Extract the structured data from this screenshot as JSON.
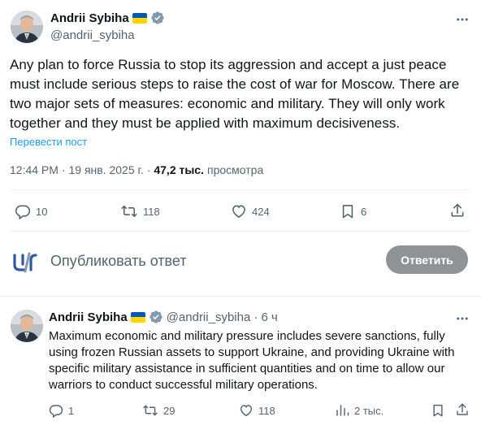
{
  "main_post": {
    "author_name": "Andrii Sybiha",
    "author_handle": "@andrii_sybiha",
    "text": "Any plan to force Russia to stop its aggression and accept a just peace must include serious steps to raise the cost of war for Moscow. There are two major sets of measures: economic and military. They will only work together and they must be applied with maximum decisiveness.",
    "translate_label": "Перевести пост",
    "time": "12:44 PM",
    "date": "· 19 янв. 2025 г. ·",
    "views_count": "47,2 тыс.",
    "views_label": "просмотра",
    "actions": {
      "replies": "10",
      "reposts": "118",
      "likes": "424",
      "bookmarks": "6"
    }
  },
  "reply_composer": {
    "placeholder": "Опубликовать ответ",
    "button_label": "Ответить"
  },
  "reply_post": {
    "author_name": "Andrii Sybiha",
    "author_handle": "@andrii_sybiha",
    "time_ago": "· 6 ч",
    "text": "Maximum economic and military pressure includes severe sanctions, fully using frozen Russian assets to support Ukraine, and providing Ukraine with specific military assistance in sufficient quantities and on time to allow our warriors to conduct successful military operations.",
    "actions": {
      "replies": "1",
      "reposts": "29",
      "likes": "118",
      "views": "2 тыс."
    }
  },
  "colors": {
    "accent": "#1d9bf0",
    "muted_text": "#536471",
    "button_disabled": "#8e9396",
    "flag_blue": "#0057b7",
    "flag_yellow": "#ffd700"
  },
  "icons": [
    "verified-icon",
    "more-icon",
    "reply-icon",
    "repost-icon",
    "like-icon",
    "bookmark-icon",
    "share-icon",
    "views-icon",
    "ukraine-flag-icon"
  ]
}
